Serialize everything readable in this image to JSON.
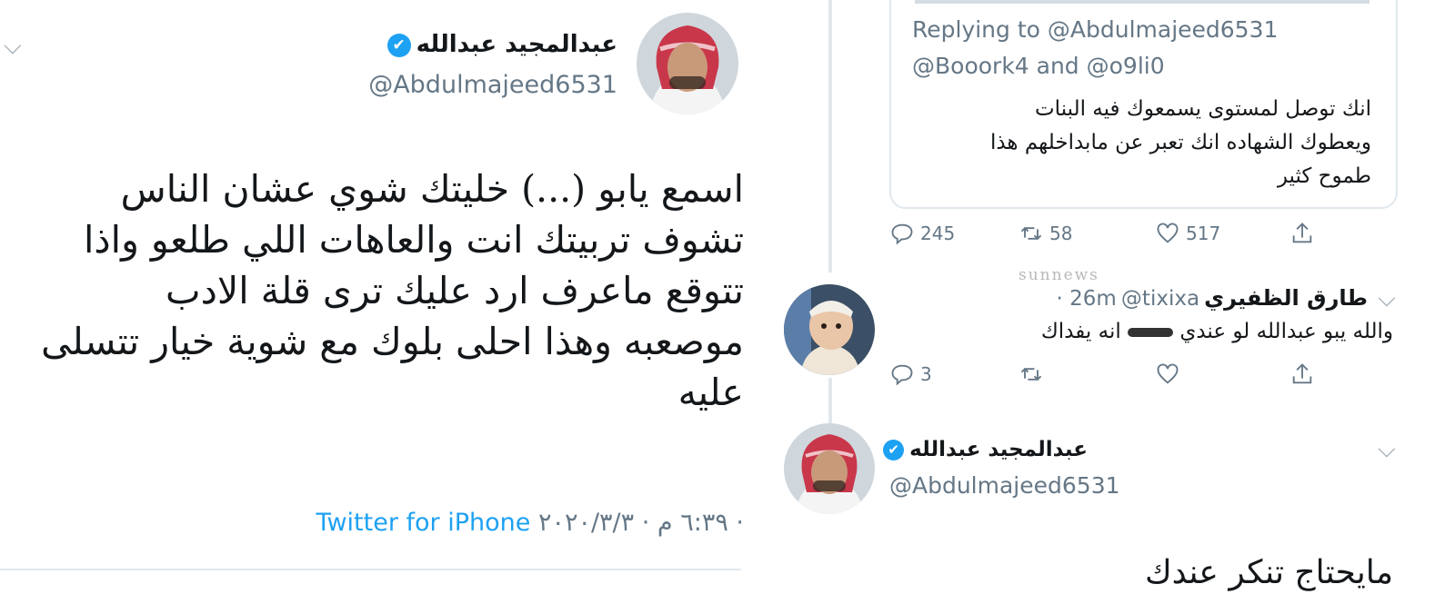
{
  "left_tweet": {
    "author_name": "عبدالمجيد عبدالله",
    "handle": "@Abdulmajeed6531",
    "text_lines": [
      "اسمع يابو (...) خليتك شوي عشان الناس",
      "تشوف تربيتك انت والعاهات اللي طلعو واذا",
      "تتوقع ماعرف ارد عليك ترى قلة الادب",
      "موصعبه وهذا احلى بلوك مع شوية خيار تتسلى",
      "عليه"
    ],
    "source": "Twitter for iPhone",
    "datetime": "٦:٣٩ م · ٢٠٢٠/٣/٣ ·"
  },
  "quoted_tweet": {
    "replying_to": "Replying to @Abdulmajeed6531",
    "mentions": "@Booork4 and @o9li0",
    "text_lines": [
      "انك توصل لمستوى يسمعوك فيه البنات",
      "ويعطوك الشهاده انك تعبر عن مابداخلهم هذا",
      "طموح كثير"
    ],
    "replies": "245",
    "retweets": "58",
    "likes": "517"
  },
  "reply_tweet": {
    "author_name": "طارق الظفيري",
    "handle": "@tixixa",
    "time": "· 26m",
    "text_before": "والله يبو عبدالله لو عندي",
    "text_after": "انه يفداك",
    "replies": "3",
    "watermark": "sunnews"
  },
  "bottom_tweet": {
    "author_name": "عبدالمجيد عبدالله",
    "handle": "@Abdulmajeed6531",
    "text": "مايحتاج تنكر عندك"
  },
  "icons": {
    "verified": "✔",
    "chevron": "⌵"
  },
  "colors": {
    "accent": "#1da1f2",
    "muted": "#657786",
    "separator": "#e1e8ed"
  }
}
